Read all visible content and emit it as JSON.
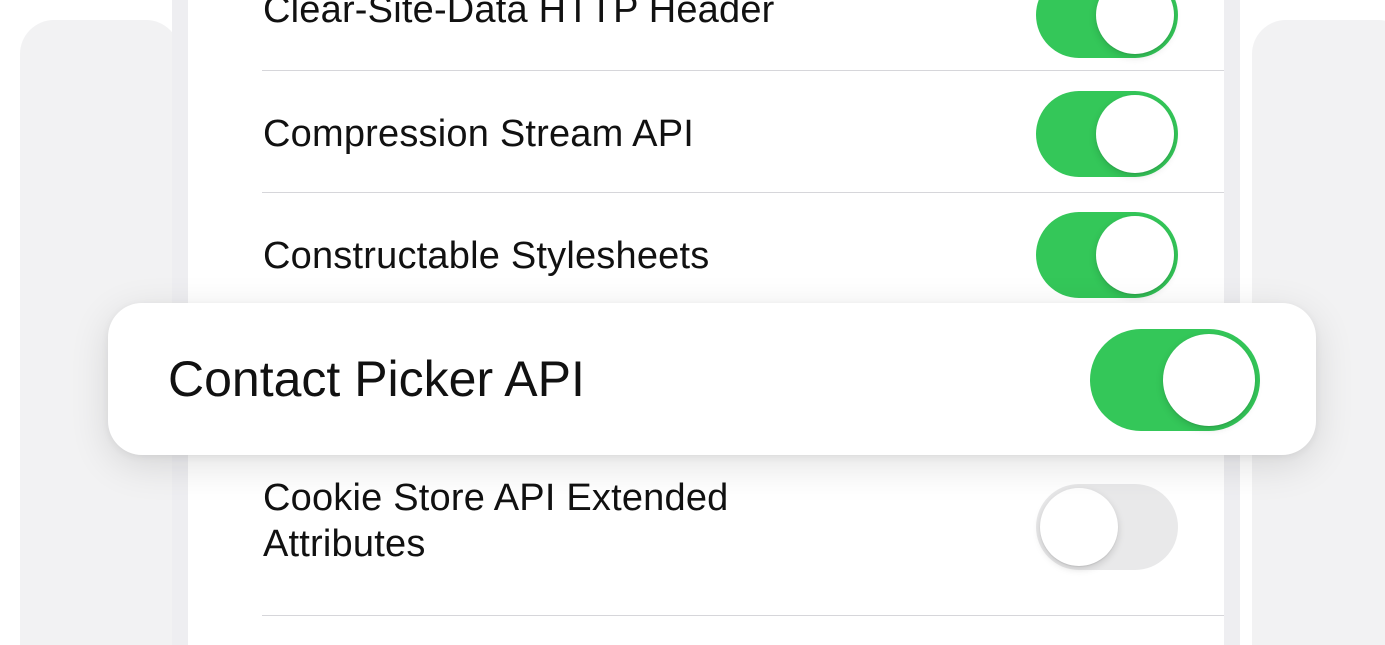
{
  "settings_rows": [
    {
      "label": "Clear-Site-Data HTTP Header",
      "enabled": true
    },
    {
      "label": "Compression Stream API",
      "enabled": true
    },
    {
      "label": "Constructable Stylesheets",
      "enabled": true
    },
    {
      "label": "Cookie Store API Extended Attributes",
      "enabled": false
    }
  ],
  "highlighted_row": {
    "label": "Contact Picker API",
    "enabled": true
  },
  "colors": {
    "toggle_on": "#34c759",
    "toggle_off": "#e9e9ea"
  }
}
